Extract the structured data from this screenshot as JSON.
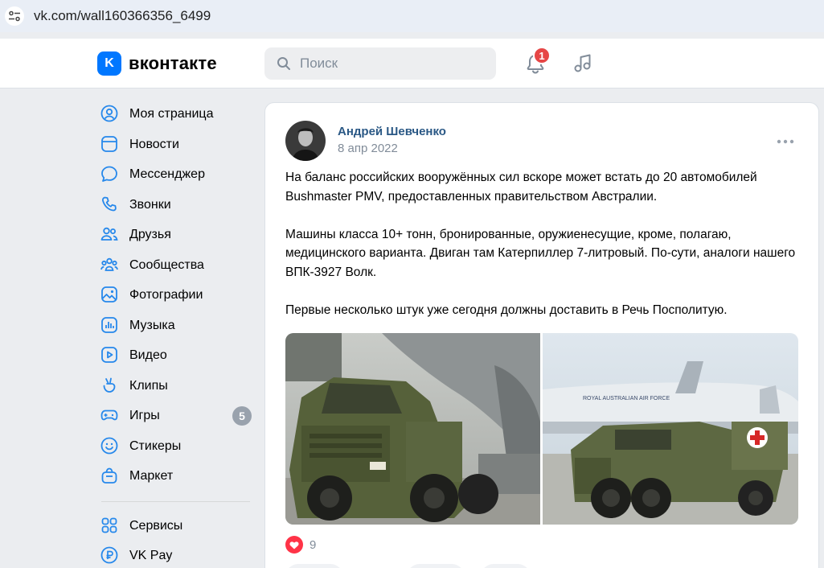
{
  "browser": {
    "url": "vk.com/wall160366356_6499"
  },
  "header": {
    "logo_letter": "K",
    "logo_text": "вконтакте",
    "search_placeholder": "Поиск",
    "notifications_count": "1"
  },
  "nav": {
    "items": [
      {
        "label": "Моя страница",
        "icon": "user-circle-icon"
      },
      {
        "label": "Новости",
        "icon": "news-icon"
      },
      {
        "label": "Мессенджер",
        "icon": "message-icon"
      },
      {
        "label": "Звонки",
        "icon": "phone-icon"
      },
      {
        "label": "Друзья",
        "icon": "friends-icon"
      },
      {
        "label": "Сообщества",
        "icon": "communities-icon"
      },
      {
        "label": "Фотографии",
        "icon": "photo-icon"
      },
      {
        "label": "Музыка",
        "icon": "music-icon"
      },
      {
        "label": "Видео",
        "icon": "video-icon"
      },
      {
        "label": "Клипы",
        "icon": "clips-icon"
      },
      {
        "label": "Игры",
        "icon": "gamepad-icon",
        "count": "5"
      },
      {
        "label": "Стикеры",
        "icon": "smile-icon"
      },
      {
        "label": "Маркет",
        "icon": "bag-icon"
      },
      {
        "label": "Сервисы",
        "icon": "grid-icon"
      },
      {
        "label": "VK Pay",
        "icon": "ruble-icon"
      }
    ]
  },
  "post": {
    "author": "Андрей Шевченко",
    "date": "8 апр 2022",
    "paragraphs": [
      "На баланс российских вооружённых сил вскоре может встать до 20 автомобилей Bushmaster PMV, предоставленных правительством Австралии.",
      "Машины класса 10+ тонн, бронированные, оружиенесущие, кроме, полагаю, медицинского варианта. Двиган там Катерпиллер 7-литровый. По-сути, аналоги нашего ВПК-3927 Волк.",
      "Первые несколько штук уже сегодня должны доставить в Речь Посполитую."
    ],
    "likes": "9",
    "plane_marking": "ROYAL AUSTRALIAN AIR FORCE"
  },
  "colors": {
    "accent": "#0077ff",
    "link": "#2a5885",
    "badge_red": "#e64646",
    "like_red": "#ff3347",
    "nav_icon": "#2688eb"
  }
}
